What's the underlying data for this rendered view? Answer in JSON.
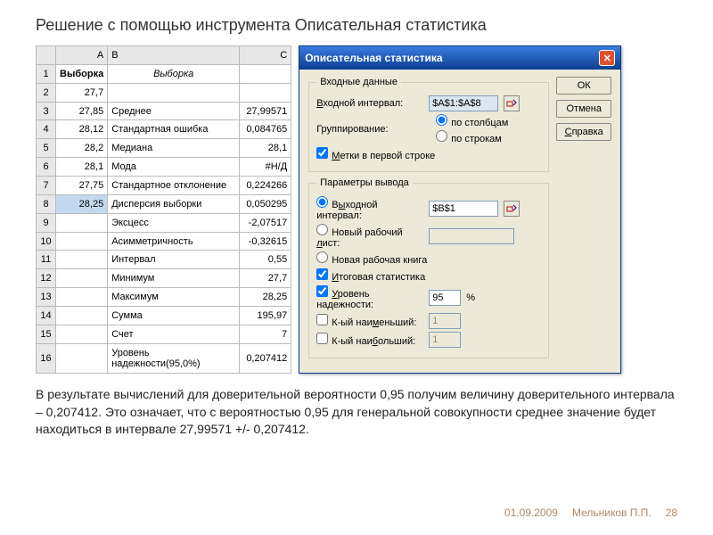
{
  "title": "Решение с помощью инструмента Описательная статистика",
  "sheet": {
    "cols": [
      "A",
      "B",
      "C"
    ],
    "rows": [
      {
        "n": "1",
        "A": "Выборка",
        "B": "Выборка",
        "C": "",
        "bold": true,
        "italicB": true
      },
      {
        "n": "2",
        "A": "27,7",
        "B": "",
        "C": ""
      },
      {
        "n": "3",
        "A": "27,85",
        "B": "Среднее",
        "C": "27,99571"
      },
      {
        "n": "4",
        "A": "28,12",
        "B": "Стандартная ошибка",
        "C": "0,084765"
      },
      {
        "n": "5",
        "A": "28,2",
        "B": "Медиана",
        "C": "28,1"
      },
      {
        "n": "6",
        "A": "28,1",
        "B": "Мода",
        "C": "#Н/Д"
      },
      {
        "n": "7",
        "A": "27,75",
        "B": "Стандартное отклонение",
        "C": "0,224266"
      },
      {
        "n": "8",
        "A": "28,25",
        "B": "Дисперсия выборки",
        "C": "0,050295",
        "sel": true
      },
      {
        "n": "9",
        "A": "",
        "B": "Эксцесс",
        "C": "-2,07517"
      },
      {
        "n": "10",
        "A": "",
        "B": "Асимметричность",
        "C": "-0,32615"
      },
      {
        "n": "11",
        "A": "",
        "B": "Интервал",
        "C": "0,55"
      },
      {
        "n": "12",
        "A": "",
        "B": "Минимум",
        "C": "27,7"
      },
      {
        "n": "13",
        "A": "",
        "B": "Максимум",
        "C": "28,25"
      },
      {
        "n": "14",
        "A": "",
        "B": "Сумма",
        "C": "195,97"
      },
      {
        "n": "15",
        "A": "",
        "B": "Счет",
        "C": "7"
      },
      {
        "n": "16",
        "A": "",
        "B": "Уровень надежности(95,0%)",
        "C": "0,207412"
      }
    ]
  },
  "dialog": {
    "title": "Описательная статистика",
    "ok": "ОК",
    "cancel": "Отмена",
    "help": "Справка",
    "group1": {
      "legend": "Входные данные",
      "input_range_lbl": "Входной интервал:",
      "input_range_val": "$A$1:$A$8",
      "grouping_lbl": "Группирование:",
      "by_cols": "по столбцам",
      "by_rows": "по строкам",
      "labels": "Метки в первой строке"
    },
    "group2": {
      "legend": "Параметры вывода",
      "out_range": "Выходной интервал:",
      "out_range_val": "$B$1",
      "new_sheet": "Новый рабочий лист:",
      "new_book": "Новая рабочая книга",
      "summary": "Итоговая статистика",
      "confidence": "Уровень надежности:",
      "confidence_val": "95",
      "pct": "%",
      "kth_small": "К-ый наименьший:",
      "kth_large": "К-ый наибольший:",
      "one": "1"
    }
  },
  "body": "В результате вычислений для доверительной вероятности 0,95 получим величину доверительного интервала – 0,207412. Это означает, что с вероятностью 0,95 для генеральной совокупности среднее значение будет находиться в интервале 27,99571 +/- 0,207412.",
  "footer": {
    "date": "01.09.2009",
    "author": "Мельников П.П.",
    "page": "28"
  }
}
